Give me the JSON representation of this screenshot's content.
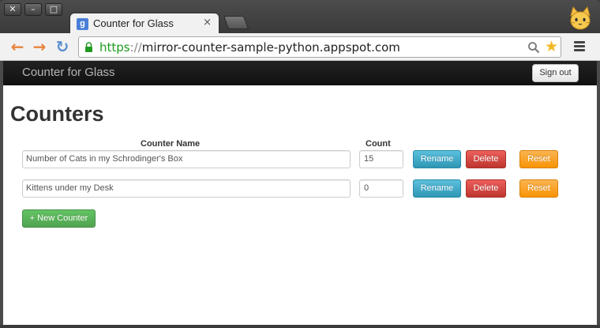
{
  "window": {
    "buttons": {
      "close": "✕",
      "minimize": "–",
      "maximize": "□"
    }
  },
  "tab": {
    "favicon_letter": "g",
    "title": "Counter for Glass",
    "close": "×"
  },
  "toolbar": {
    "url_scheme": "https",
    "url_separator": "://",
    "url_host": "mirror-counter-sample-python.appspot.com",
    "star_glyph": "★"
  },
  "colors": {
    "info": "#5bc0de",
    "danger": "#ee5f5b",
    "warning": "#fbb450",
    "success": "#62c462",
    "url_green": "#1f9a1f"
  },
  "appbar": {
    "brand": "Counter for Glass",
    "signout_label": "Sign out"
  },
  "main": {
    "title": "Counters",
    "columns": {
      "name": "Counter Name",
      "count": "Count"
    },
    "counters": [
      {
        "name": "Number of Cats in my Schrodinger's Box",
        "count": "15"
      },
      {
        "name": "Kittens under my Desk",
        "count": "0"
      }
    ],
    "actions": {
      "rename": "Rename",
      "delete": "Delete",
      "reset": "Reset"
    },
    "new_counter_label": "+ New Counter"
  }
}
